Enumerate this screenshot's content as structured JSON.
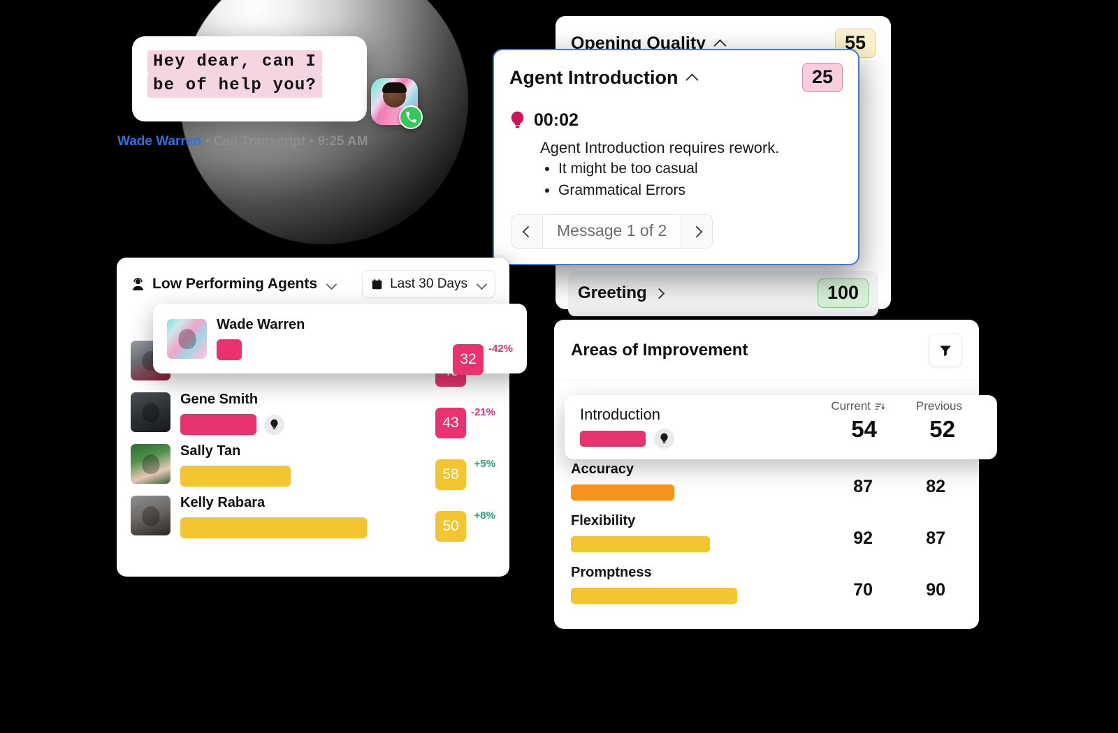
{
  "transcript": {
    "lines": [
      "Hey dear, can I",
      "be of help you?"
    ],
    "speaker": "Wade Warren",
    "source": "Call Transcript",
    "time": "9:25 AM",
    "sep1": "•",
    "sep2": "•",
    "avatar_name": "wade-warren-avatar",
    "call_icon": "phone-icon"
  },
  "opening_quality": {
    "title": "Opening Quality",
    "score": "55",
    "chevron": "chevron-up-icon"
  },
  "greeting": {
    "title": "Greeting",
    "score": "100",
    "chevron": "chevron-right-icon"
  },
  "agent_introduction": {
    "title": "Agent Introduction",
    "score": "25",
    "chevron": "chevron-up-icon",
    "timestamp": "00:02",
    "bulb_icon": "lightbulb-icon",
    "headline": "Agent Introduction requires rework.",
    "bullets": [
      "It might be too casual",
      "Grammatical Errors"
    ],
    "pager": {
      "prev_icon": "chevron-left-icon",
      "label": "Message 1 of 2",
      "next_icon": "chevron-right-icon"
    }
  },
  "low_performing_agents": {
    "title": "Low Performing Agents",
    "title_icon": "agent-headset-icon",
    "title_chevron": "chevron-down-icon",
    "date_filter": {
      "icon": "calendar-icon",
      "label": "Last 30 Days",
      "chevron": "chevron-down-icon"
    },
    "rows": [
      {
        "name": "Wade Warren",
        "score": "32",
        "delta": "-42%",
        "delta_dir": "neg",
        "bar_pct": 11,
        "bar_color": "pink",
        "bulb": false
      },
      {
        "name": "",
        "score": "43",
        "delta": "",
        "delta_dir": "neg",
        "bar_pct": 22,
        "bar_color": "pink",
        "bulb": false
      },
      {
        "name": "Gene Smith",
        "score": "43",
        "delta": "-21%",
        "delta_dir": "neg",
        "bar_pct": 33,
        "bar_color": "pink",
        "bulb": true
      },
      {
        "name": "Sally Tan",
        "score": "58",
        "delta": "+5%",
        "delta_dir": "pos",
        "bar_pct": 48,
        "bar_color": "yellow",
        "bulb": false
      },
      {
        "name": "Kelly Rabara",
        "score": "50",
        "delta": "+8%",
        "delta_dir": "pos",
        "bar_pct": 81,
        "bar_color": "yellow",
        "bulb": false
      }
    ]
  },
  "areas_of_improvement": {
    "title": "Areas of Improvement",
    "filter_icon": "filter-icon",
    "columns": {
      "current": "Current",
      "previous": "Previous",
      "sort_icon": "sort-descending-icon"
    },
    "featured": {
      "name": "Introduction",
      "current": "54",
      "previous": "52",
      "bar_pct": 24,
      "bar_color": "pink",
      "bulb_icon": "lightbulb-icon"
    },
    "metrics": [
      {
        "name": "Accuracy",
        "current": "87",
        "previous": "82",
        "bar_pct": 38,
        "bar_color": "orange"
      },
      {
        "name": "Flexibility",
        "current": "92",
        "previous": "87",
        "bar_pct": 51,
        "bar_color": "yellow"
      },
      {
        "name": "Promptness",
        "current": "70",
        "previous": "90",
        "bar_pct": 61,
        "bar_color": "yellow"
      }
    ]
  },
  "colors": {
    "pink": "#e8336f",
    "yellow": "#f2c531",
    "orange": "#f7941e",
    "green": "#2fa37a",
    "blue_outline": "#4679d4",
    "link_blue": "#2f6fe0"
  }
}
